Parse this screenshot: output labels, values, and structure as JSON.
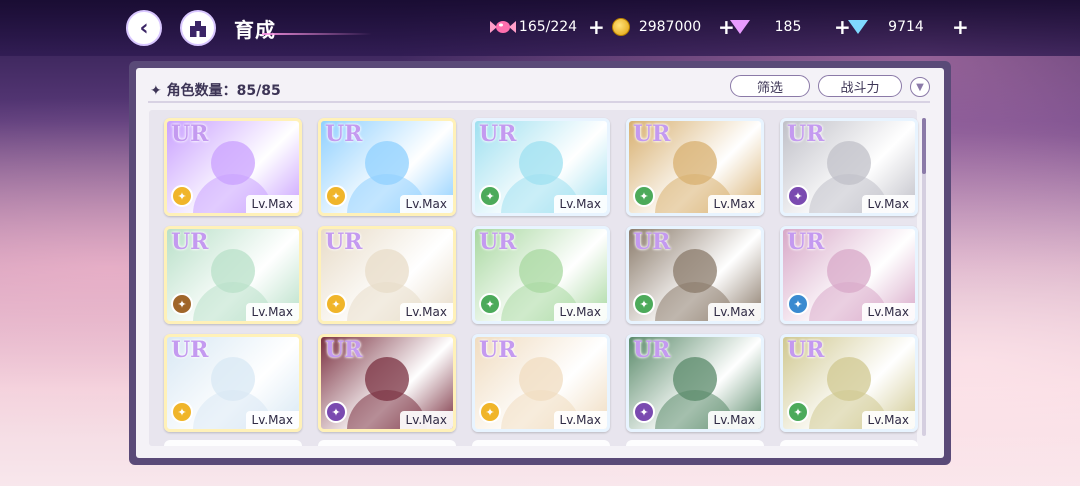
{
  "header": {
    "title": "育成"
  },
  "resources": [
    {
      "icon": "candy-icon",
      "value": "165/224"
    },
    {
      "icon": "gold-coin-icon",
      "value": "2987000"
    },
    {
      "icon": "pink-gem-icon",
      "value": "185"
    },
    {
      "icon": "blue-diamond-icon",
      "value": "9714"
    }
  ],
  "panel": {
    "count_label": "✦ 角色数量：85/85",
    "filter_label": "筛选",
    "sort_label": "战斗力"
  },
  "cards": [
    {
      "rarity": "UR",
      "level": "Lv.Max",
      "attr_color": "#f0b52a",
      "tint": "#c9a0ff"
    },
    {
      "rarity": "UR",
      "level": "Lv.Max",
      "attr_color": "#f0b52a",
      "tint": "#8fd0ff"
    },
    {
      "rarity": "UR",
      "level": "Lv.Max",
      "attr_color": "#4caa5a",
      "tint": "#9ee0f0"
    },
    {
      "rarity": "UR",
      "level": "Lv.Max",
      "attr_color": "#4caa5a",
      "tint": "#d8b070"
    },
    {
      "rarity": "UR",
      "level": "Lv.Max",
      "attr_color": "#7a4ab0",
      "tint": "#c0c0c8"
    },
    {
      "rarity": "UR",
      "level": "Lv.Max",
      "attr_color": "#a0662a",
      "tint": "#b8e0c8"
    },
    {
      "rarity": "UR",
      "level": "Lv.Max",
      "attr_color": "#f0b52a",
      "tint": "#e8dcc8"
    },
    {
      "rarity": "UR",
      "level": "Lv.Max",
      "attr_color": "#4caa5a",
      "tint": "#a8d8a0"
    },
    {
      "rarity": "UR",
      "level": "Lv.Max",
      "attr_color": "#4caa5a",
      "tint": "#8a7a6a"
    },
    {
      "rarity": "UR",
      "level": "Lv.Max",
      "attr_color": "#3a8ad0",
      "tint": "#d8a8c8"
    },
    {
      "rarity": "UR",
      "level": "Lv.Max",
      "attr_color": "#f0b52a",
      "tint": "#d8e8f4"
    },
    {
      "rarity": "UR",
      "level": "Lv.Max",
      "attr_color": "#7a4ab0",
      "tint": "#7a3040"
    },
    {
      "rarity": "UR",
      "level": "Lv.Max",
      "attr_color": "#f0b52a",
      "tint": "#f0dcc0"
    },
    {
      "rarity": "UR",
      "level": "Lv.Max",
      "attr_color": "#7a4ab0",
      "tint": "#5a8a6a"
    },
    {
      "rarity": "UR",
      "level": "Lv.Max",
      "attr_color": "#4caa5a",
      "tint": "#d0c890"
    }
  ],
  "colors": {
    "panel_frame": "#5a4a78",
    "accent": "#8b7aa8"
  }
}
